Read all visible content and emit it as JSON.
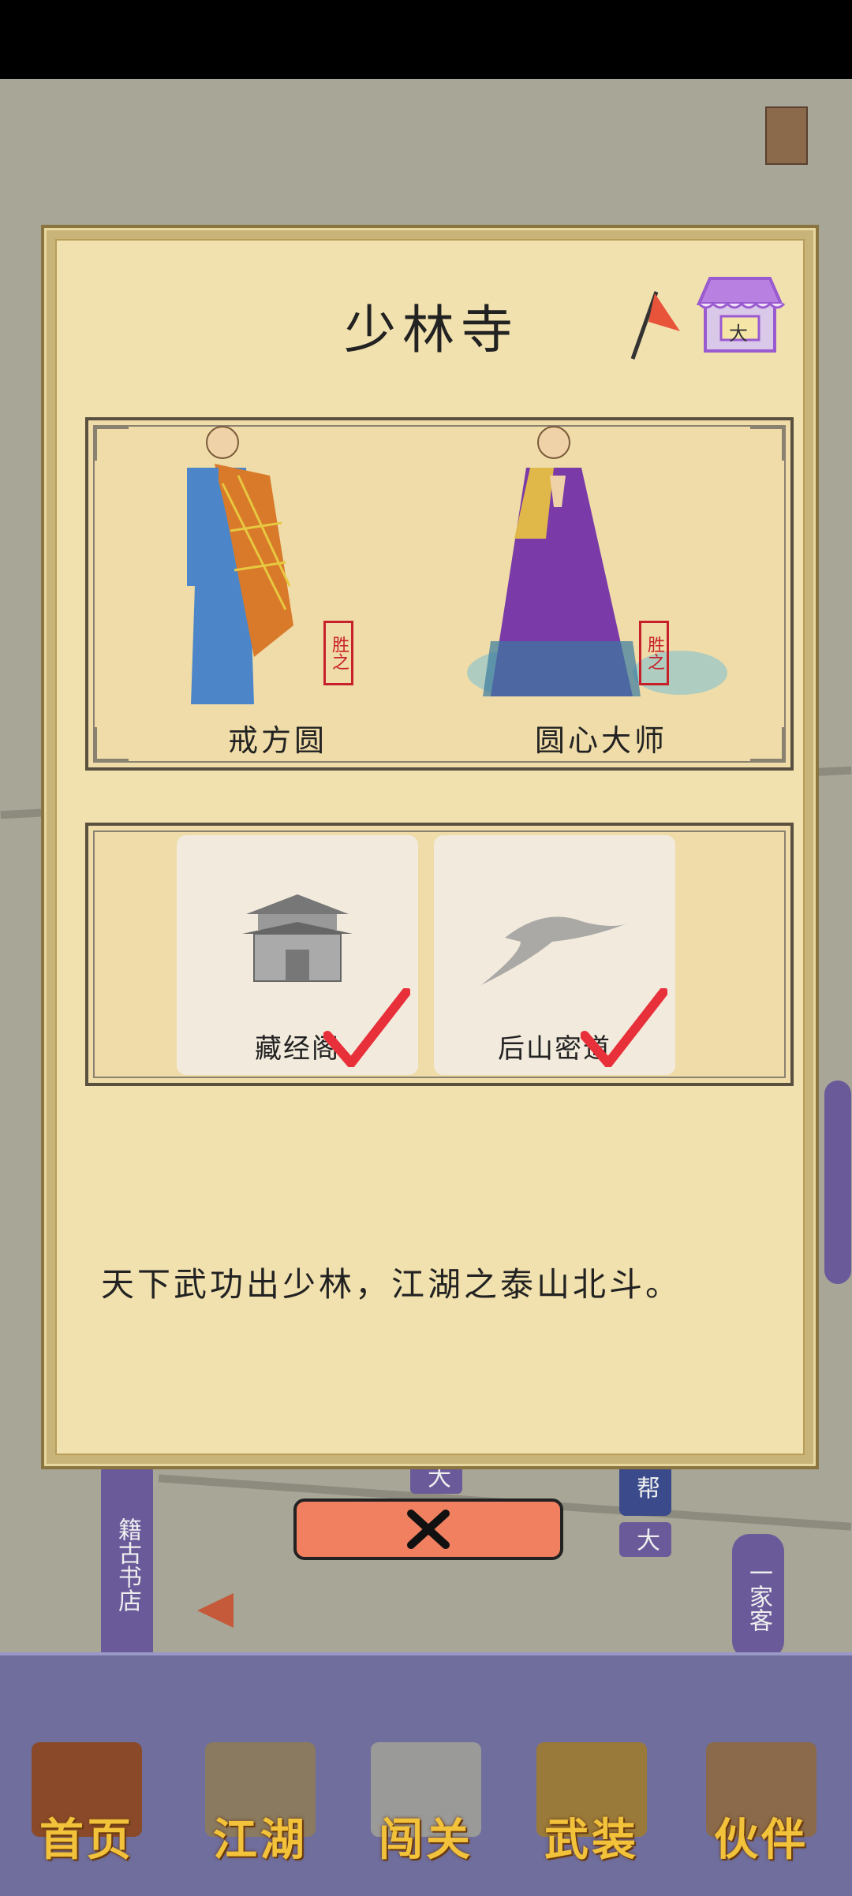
{
  "dialog": {
    "title": "少林寺",
    "shop_badge": "大",
    "npcs": [
      {
        "name": "戒方圆",
        "seal": "胜之"
      },
      {
        "name": "圆心大师",
        "seal": "胜之"
      }
    ],
    "places": [
      {
        "name": "藏经阁",
        "completed": true
      },
      {
        "name": "后山密道",
        "completed": true
      }
    ],
    "description": "天下武功出少林，江湖之泰山北斗。"
  },
  "map": {
    "labels": [
      "籍古书店",
      "帮",
      "大",
      "大",
      "一家客"
    ]
  },
  "nav": [
    {
      "label": "首页",
      "icon": "house-icon"
    },
    {
      "label": "江湖",
      "icon": "scroll-map-icon"
    },
    {
      "label": "闯关",
      "icon": "crossed-swords-icon"
    },
    {
      "label": "武装",
      "icon": "armor-icon"
    },
    {
      "label": "伙伴",
      "icon": "companions-icon"
    }
  ],
  "colors": {
    "accent": "#f08060",
    "nav_bg": "#6f6e9c",
    "nav_text": "#f2c23a",
    "check": "#e8303a"
  }
}
